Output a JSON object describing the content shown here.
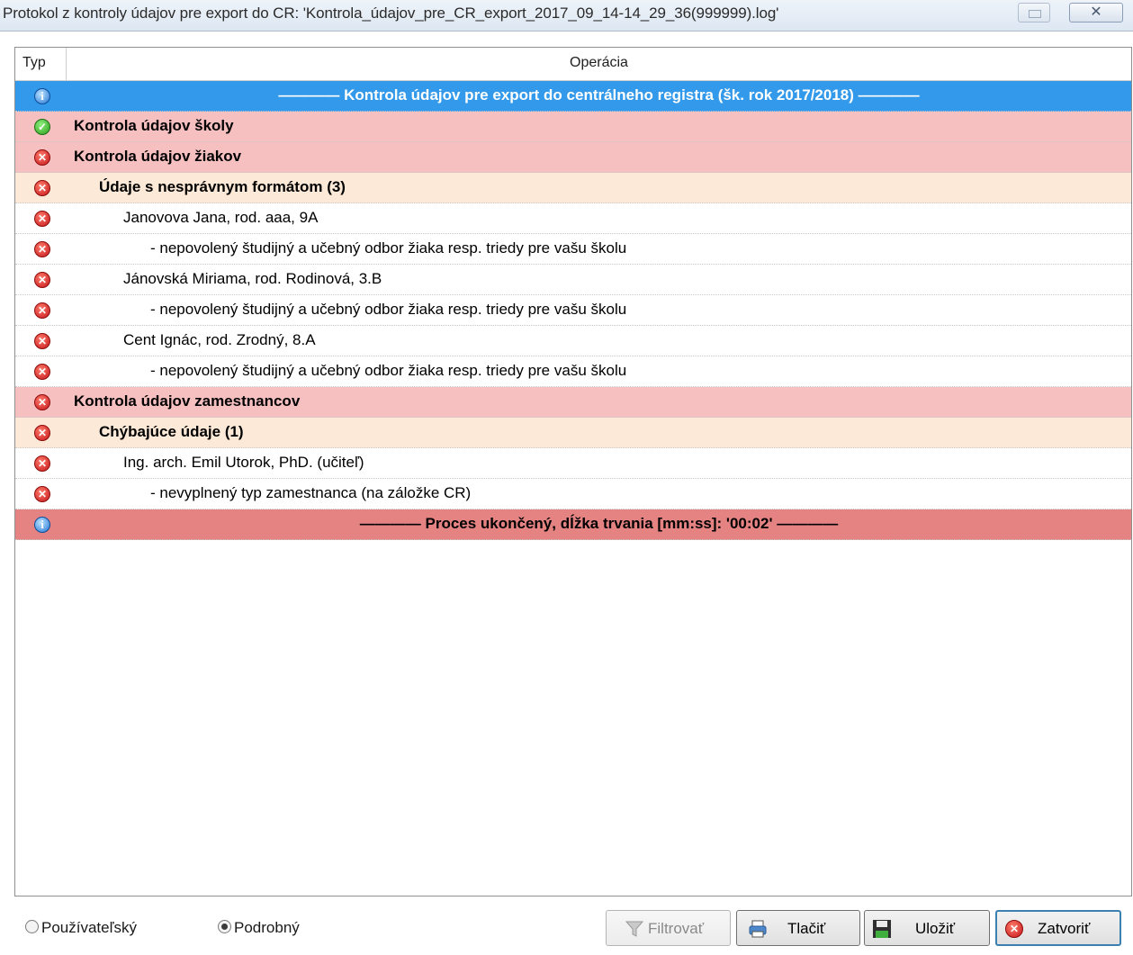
{
  "window": {
    "title": "Protokol z kontroly údajov pre export do CR: 'Kontrola_údajov_pre_CR_export_2017_09_14-14_29_36(999999).log'",
    "close_symbol": "✕"
  },
  "grid": {
    "columns": [
      "Typ",
      "Operácia"
    ],
    "rows": [
      {
        "icon": "info-icon",
        "text": "———— Kontrola údajov pre export do centrálneho registra (šk. rok 2017/2018) ————"
      },
      {
        "icon": "check-icon",
        "text": "Kontrola údajov školy"
      },
      {
        "icon": "error-icon",
        "text": "Kontrola údajov žiakov"
      },
      {
        "icon": "error-icon",
        "text": "Údaje s nesprávnym formátom (3)"
      },
      {
        "icon": "error-icon",
        "text": "Janovova Jana, rod. aaa, 9A"
      },
      {
        "icon": "error-icon",
        "text": "- nepovolený študijný a učebný odbor žiaka resp. triedy pre vašu školu"
      },
      {
        "icon": "error-icon",
        "text": "Jánovská Miriama, rod. Rodinová, 3.B"
      },
      {
        "icon": "error-icon",
        "text": "- nepovolený študijný a učebný odbor žiaka resp. triedy pre vašu školu"
      },
      {
        "icon": "error-icon",
        "text": "Cent Ignác, rod. Zrodný, 8.A"
      },
      {
        "icon": "error-icon",
        "text": "- nepovolený študijný a učebný odbor žiaka resp. triedy pre vašu školu"
      },
      {
        "icon": "error-icon",
        "text": "Kontrola údajov zamestnancov"
      },
      {
        "icon": "error-icon",
        "text": "Chýbajúce údaje (1)"
      },
      {
        "icon": "error-icon",
        "text": "Ing. arch. Emil Utorok, PhD. (učiteľ)"
      },
      {
        "icon": "error-icon",
        "text": "- nevyplnený typ zamestnanca (na záložke CR)"
      },
      {
        "icon": "info-icon",
        "text": "———— Proces ukončený, dĺžka trvania [mm:ss]: '00:02' ————"
      }
    ]
  },
  "icons": {
    "info": "i",
    "check": "✓",
    "error": "✕"
  },
  "colors": {
    "header_blue": "#3399ea",
    "section_pink": "#f7c0c0",
    "group_peach": "#fde9d7",
    "end_red": "#e58383"
  },
  "footer": {
    "mode_options": [
      "Používateľský",
      "Podrobný"
    ],
    "selected_mode": "Podrobný",
    "buttons": {
      "filter": "Filtrovať",
      "print": "Tlačiť",
      "save": "Uložiť",
      "close": "Zatvoriť"
    }
  }
}
